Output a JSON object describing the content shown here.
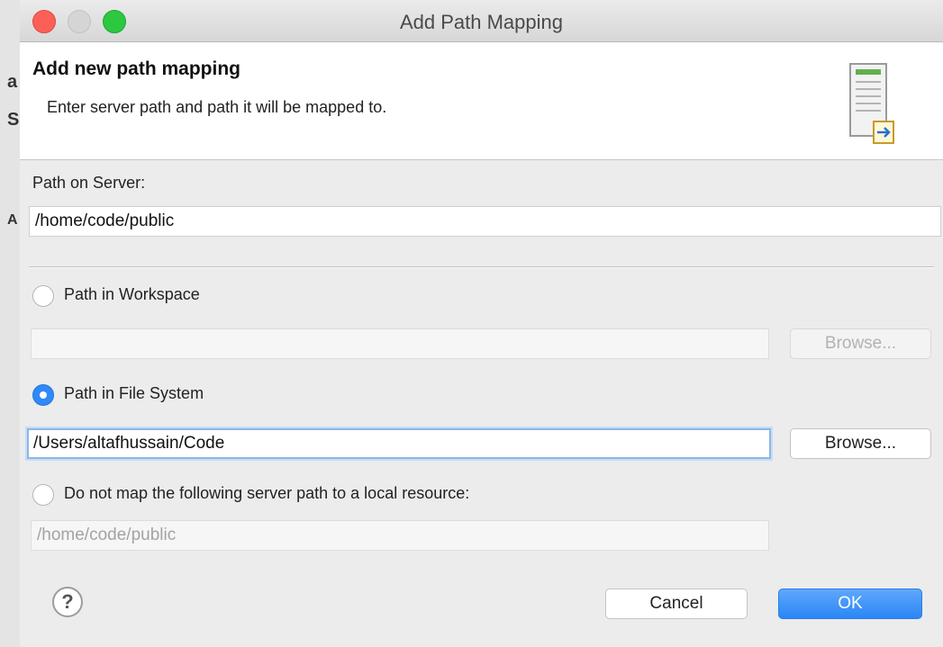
{
  "window": {
    "title": "Add Path Mapping"
  },
  "background_fragments": [
    "a",
    "S",
    "A"
  ],
  "header": {
    "title": "Add new path mapping",
    "description": "Enter server path and path it will be mapped to.",
    "icon": "server-icon"
  },
  "server_path": {
    "label": "Path on Server:",
    "value": "/home/code/public"
  },
  "workspace": {
    "label": "Path in Workspace",
    "selected": false,
    "value": "",
    "browse_label": "Browse...",
    "browse_enabled": false
  },
  "filesystem": {
    "label": "Path in File System",
    "selected": true,
    "value": "/Users/altafhussain/Code",
    "browse_label": "Browse...",
    "browse_enabled": true
  },
  "no_map": {
    "label": "Do not map the following server path to a local resource:",
    "selected": false,
    "value": "/home/code/public"
  },
  "footer": {
    "help_glyph": "?",
    "cancel_label": "Cancel",
    "ok_label": "OK"
  },
  "colors": {
    "accent": "#2f8af8",
    "close": "#fc5f57",
    "minimize": "#d5d5d5",
    "zoom": "#2bc840"
  }
}
